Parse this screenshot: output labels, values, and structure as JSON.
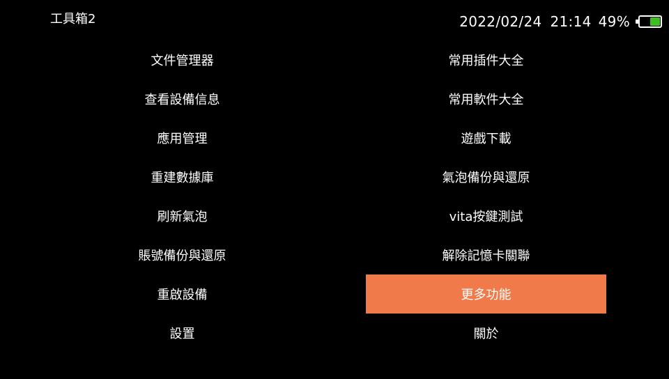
{
  "header": {
    "app_title": "工具箱2"
  },
  "status": {
    "date": "2022/02/24",
    "time": "21:14",
    "battery_percent_label": "49%",
    "battery_level": 0.49,
    "battery_color": "#3fbf1f"
  },
  "colors": {
    "background": "#000000",
    "text": "#ffffff",
    "selection": "#f07a4a"
  },
  "menu": {
    "left": [
      {
        "label": "文件管理器"
      },
      {
        "label": "查看設備信息"
      },
      {
        "label": "應用管理"
      },
      {
        "label": "重建數據庫"
      },
      {
        "label": "刷新氣泡"
      },
      {
        "label": "賬號備份與還原"
      },
      {
        "label": "重啟設備"
      },
      {
        "label": "設置"
      }
    ],
    "right": [
      {
        "label": "常用插件大全"
      },
      {
        "label": "常用軟件大全"
      },
      {
        "label": "遊戲下載"
      },
      {
        "label": "氣泡備份與還原"
      },
      {
        "label": "vita按鍵測試"
      },
      {
        "label": "解除記憶卡關聯"
      },
      {
        "label": "更多功能",
        "selected": true
      },
      {
        "label": "關於"
      }
    ]
  }
}
